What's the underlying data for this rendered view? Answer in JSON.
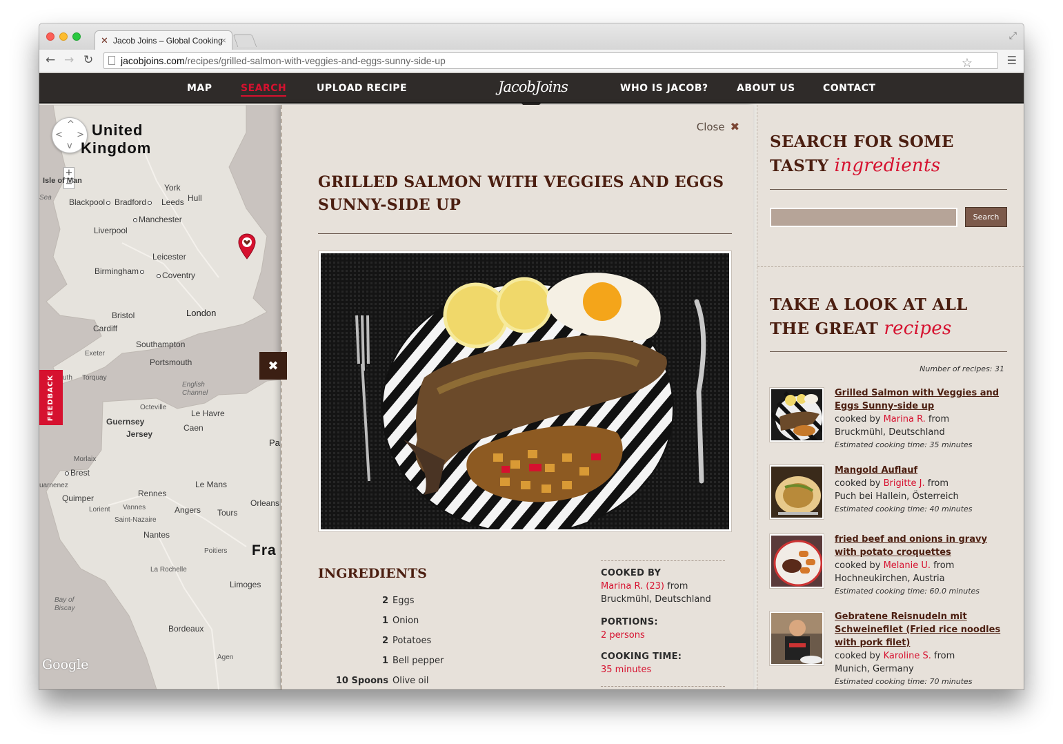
{
  "browser": {
    "tab_title": "Jacob Joins – Global Cooking",
    "url_host": "jacobjoins.com",
    "url_path": "/recipes/grilled-salmon-with-veggies-and-eggs-sunny-side-up"
  },
  "nav": {
    "items": [
      "MAP",
      "SEARCH",
      "UPLOAD RECIPE",
      "WHO IS JACOB?",
      "ABOUT US",
      "CONTACT"
    ],
    "active": "SEARCH",
    "logo": "JacobJoins"
  },
  "map": {
    "labels": {
      "uk": "United Kingdom",
      "isle": "Isle of Man",
      "sea": "Sea",
      "york": "York",
      "hull": "Hull",
      "blackpool": "Blackpool",
      "bradford": "Bradford",
      "leeds": "Leeds",
      "manchester": "Manchester",
      "liverpool": "Liverpool",
      "leicester": "Leicester",
      "birmingham": "Birmingham",
      "coventry": "Coventry",
      "london": "London",
      "bristol": "Bristol",
      "cardiff": "Cardiff",
      "southampton": "Southampton",
      "exeter": "Exeter",
      "portsmouth": "Portsmouth",
      "torquay": "Torquay",
      "plymouth": "uth",
      "english_channel": "English Channel",
      "octeville": "Octeville",
      "le_havre": "Le Havre",
      "guernsey": "Guernsey",
      "jersey": "Jersey",
      "caen": "Caen",
      "pa": "Pa",
      "morlaix": "Morlaix",
      "brest": "Brest",
      "douarnenez": "uarnenez",
      "quimper": "Quimper",
      "rennes": "Rennes",
      "le_mans": "Le Mans",
      "lorient": "Lorient",
      "vannes": "Vannes",
      "angers": "Angers",
      "tours": "Tours",
      "orleans": "Orleans",
      "saint_nazaire": "Saint-Nazaire",
      "nantes": "Nantes",
      "france": "Fra",
      "poitiers": "Poitiers",
      "la_rochelle": "La Rochelle",
      "limoges": "Limoges",
      "bay_of_biscay": "Bay of Biscay",
      "bordeaux": "Bordeaux",
      "agen": "Agen",
      "google": "Google"
    },
    "feedback": "FEEDBACK"
  },
  "recipe": {
    "close_label": "Close",
    "title": "GRILLED SALMON WITH VEGGIES AND EGGS SUNNY-SIDE UP",
    "ingredients_heading": "INGREDIENTS",
    "ingredients": [
      {
        "qty": "2",
        "name": "Eggs"
      },
      {
        "qty": "1",
        "name": "Onion"
      },
      {
        "qty": "2",
        "name": "Potatoes"
      },
      {
        "qty": "1",
        "name": "Bell pepper"
      },
      {
        "qty": "10 Spoons",
        "name": "Olive oil"
      }
    ],
    "cooked_by_heading": "COOKED BY",
    "cook_name": "Marina R. (23)",
    "cook_from": "from",
    "cook_place": "Bruckmühl, Deutschland",
    "portions_heading": "PORTIONS:",
    "portions": "2 persons",
    "time_heading": "COOKING TIME:",
    "time": "35 minutes"
  },
  "sidebar": {
    "search_heading_1": "SEARCH FOR SOME",
    "search_heading_2": "TASTY",
    "search_heading_script": "ingredients",
    "search_button": "Search",
    "search_value": "",
    "recipes_heading_1": "TAKE A LOOK AT ALL",
    "recipes_heading_2": "THE GREAT",
    "recipes_heading_script": "recipes",
    "count_label": "Number of recipes: 31",
    "recipes": [
      {
        "title": "Grilled Salmon with Veggies and Eggs Sunny-side up",
        "cooked_by": "cooked by",
        "cook": "Marina R.",
        "from": "from",
        "place": "Bruckmühl, Deutschland",
        "time": "Estimated cooking time: 35 minutes"
      },
      {
        "title": "Mangold Auflauf",
        "cooked_by": "cooked by",
        "cook": "Brigitte J.",
        "from": "from",
        "place": "Puch bei Hallein, Österreich",
        "time": "Estimated cooking time: 40 minutes"
      },
      {
        "title": "fried beef and onions in gravy with potato croquettes",
        "cooked_by": "cooked by",
        "cook": "Melanie U.",
        "from": "from",
        "place": "Hochneukirchen, Austria",
        "time": "Estimated cooking time: 60.0 minutes"
      },
      {
        "title": "Gebratene Reisnudeln mit Schweinefilet (Fried rice noodles with pork filet)",
        "cooked_by": "cooked by",
        "cook": "Karoline S.",
        "from": "from",
        "place": "Munich, Germany",
        "time": "Estimated cooking time: 70 minutes"
      }
    ]
  },
  "colors": {
    "brand_red": "#d6112f",
    "brown_heading": "#4b1e10",
    "nav_bg": "#2f2b29",
    "paper_bg": "#e7e1da"
  }
}
